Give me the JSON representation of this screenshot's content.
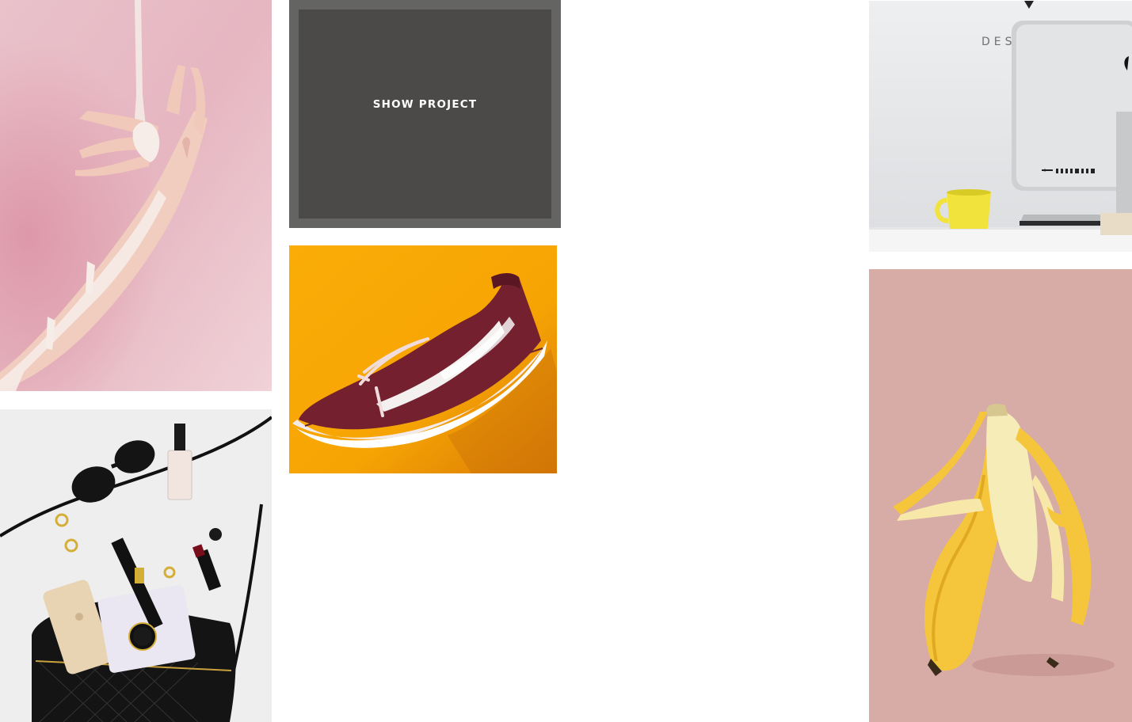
{
  "gallery": {
    "tiles": [
      {
        "id": "hand",
        "subject": "hand dipped in pink paint"
      },
      {
        "id": "show",
        "overlay_label": "SHOW PROJECT"
      },
      {
        "id": "sneaker",
        "subject": "burgundy sneaker on yellow"
      },
      {
        "id": "bag",
        "subject": "handbag with accessories"
      },
      {
        "id": "desk",
        "subject": "desk with monitor and yellow mug"
      },
      {
        "id": "banana",
        "subject": "peeled banana on pink"
      }
    ],
    "desk_sign_text": "DES",
    "colors": {
      "overlay": "#4b4a49",
      "overlay_border": "#646463",
      "pink": "#e8bcc6",
      "yellow": "#f8ab06",
      "banana_bg": "#d6aaa5"
    }
  }
}
